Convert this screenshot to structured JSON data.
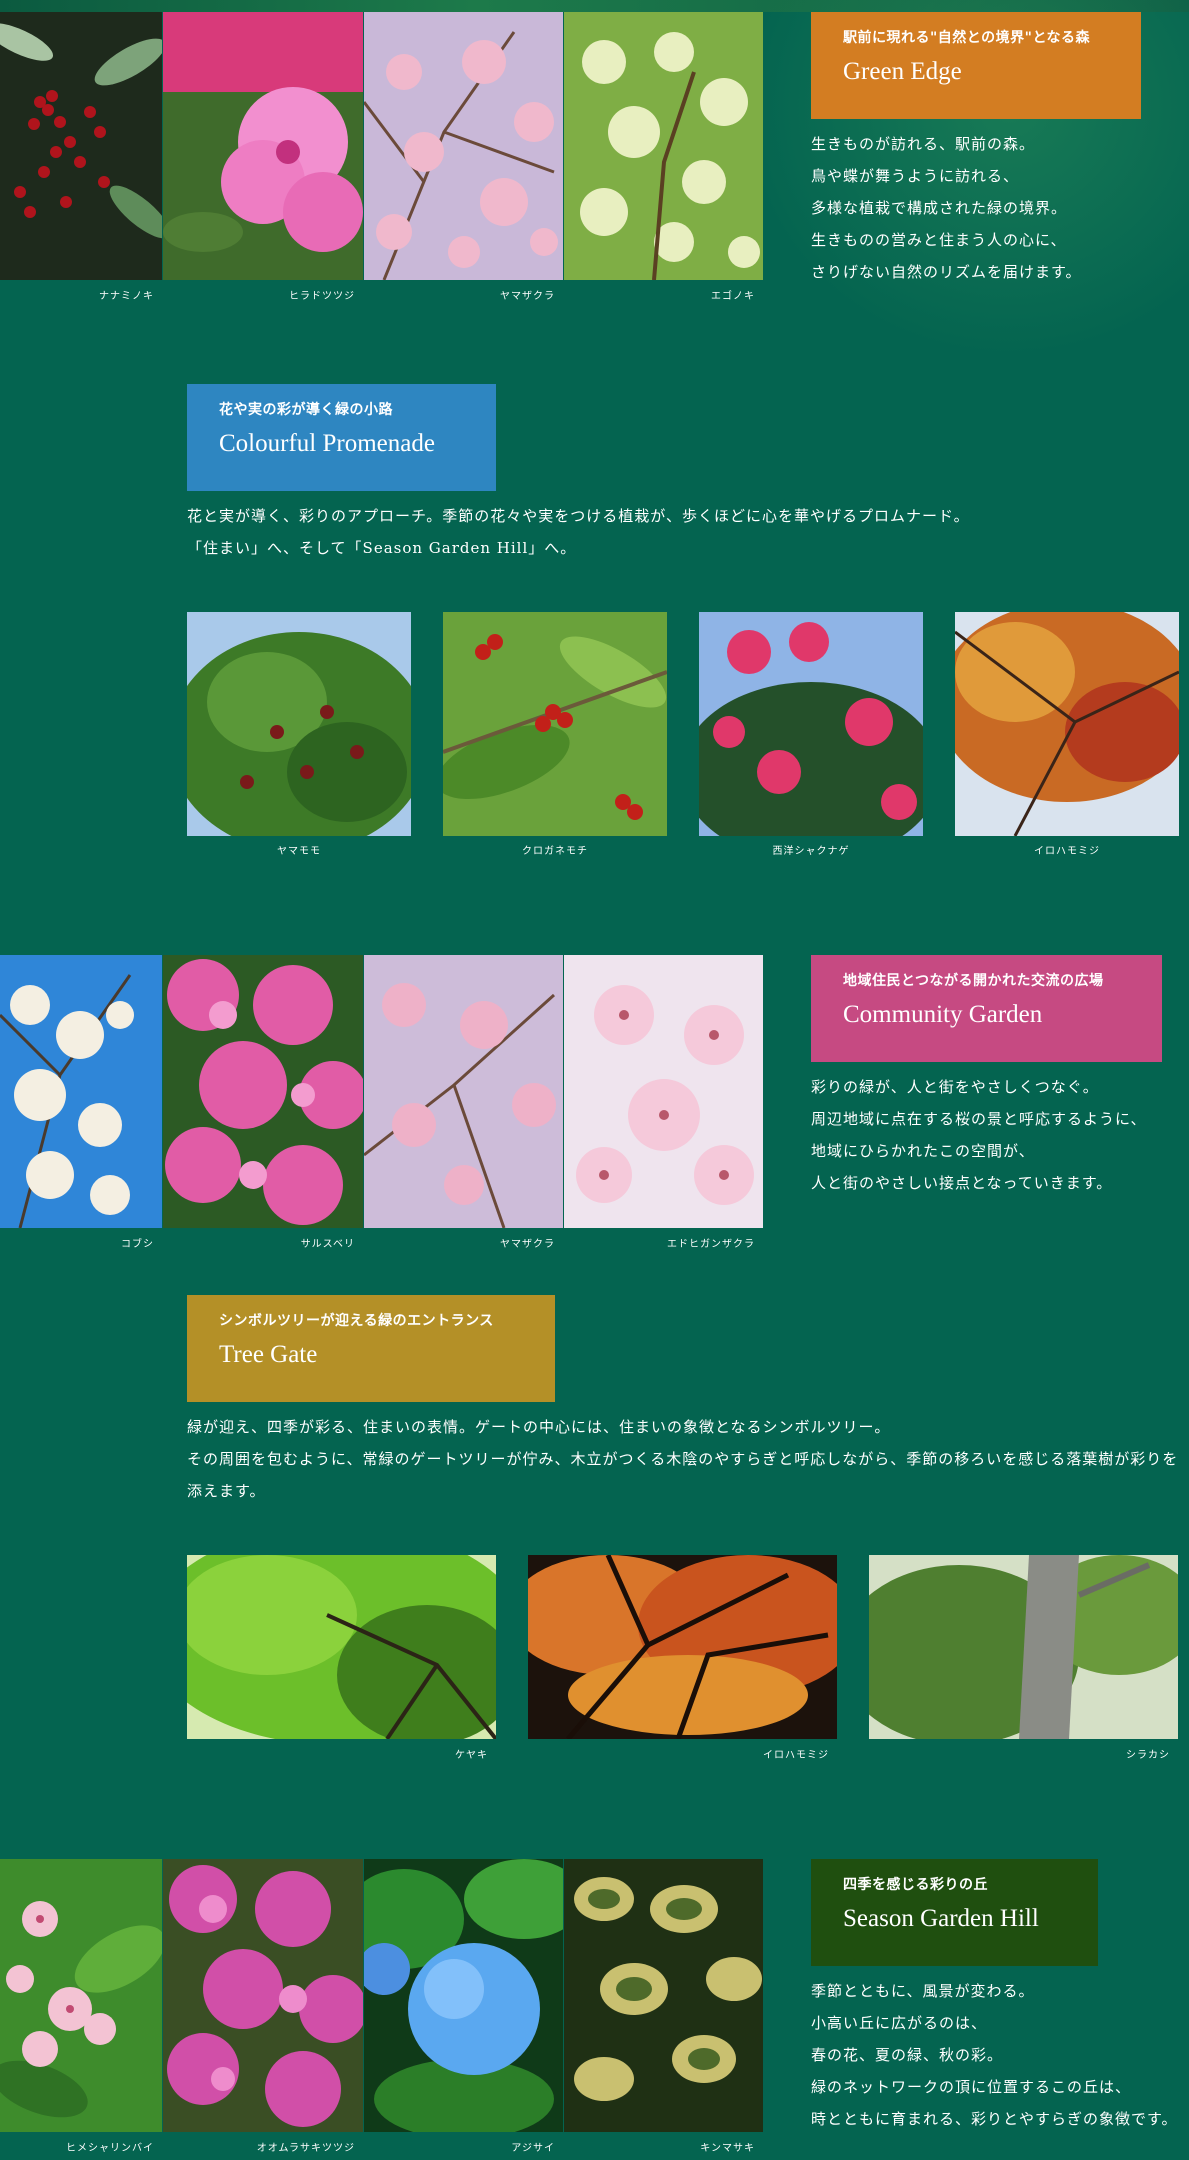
{
  "colors": {
    "background": "#046450",
    "green_edge": "#d37d22",
    "colourful_promenade": "#2e86c1",
    "community_garden": "#c64a82",
    "tree_gate": "#b49027",
    "season_garden_hill": "#1f4f0f"
  },
  "sections": {
    "green_edge": {
      "subtitle": "駅前に現れる\"自然との境界\"となる森",
      "title": "Green Edge",
      "lines": [
        "生きものが訪れる、駅前の森。",
        "鳥や蝶が舞うように訪れる、",
        "多様な植栽で構成された緑の境界。",
        "生きものの営みと住まう人の心に、",
        "さりげない自然のリズムを届けます。"
      ],
      "photos": [
        {
          "caption": "ナナミノキ",
          "icon": "holly-berries-photo"
        },
        {
          "caption": "ヒラドツツジ",
          "icon": "azalea-photo"
        },
        {
          "caption": "ヤマザクラ",
          "icon": "cherry-blossom-photo"
        },
        {
          "caption": "エゴノキ",
          "icon": "snowbell-photo"
        }
      ]
    },
    "colourful_promenade": {
      "subtitle": "花や実の彩が導く緑の小路",
      "title": "Colourful Promenade",
      "lines": [
        "花と実が導く、彩りのアプローチ。季節の花々や実をつける植栽が、歩くほどに心を華やげるプロムナード。",
        "「住まい」へ、そして「Season Garden Hill」へ。"
      ],
      "photos": [
        {
          "caption": "ヤマモモ",
          "icon": "bayberry-photo"
        },
        {
          "caption": "クロガネモチ",
          "icon": "holly-photo"
        },
        {
          "caption": "西洋シャクナゲ",
          "icon": "rhododendron-photo"
        },
        {
          "caption": "イロハモミジ",
          "icon": "maple-photo"
        }
      ]
    },
    "community_garden": {
      "subtitle": "地域住民とつながる開かれた交流の広場",
      "title": "Community Garden",
      "lines": [
        "彩りの緑が、人と街をやさしくつなぐ。",
        "周辺地域に点在する桜の景と呼応するように、",
        "地域にひらかれたこの空間が、",
        "人と街のやさしい接点となっていきます。"
      ],
      "photos": [
        {
          "caption": "コブシ",
          "icon": "magnolia-photo"
        },
        {
          "caption": "サルスベリ",
          "icon": "crape-myrtle-photo"
        },
        {
          "caption": "ヤマザクラ",
          "icon": "cherry-blossom-photo"
        },
        {
          "caption": "エドヒガンザクラ",
          "icon": "edo-higan-cherry-photo"
        }
      ]
    },
    "tree_gate": {
      "subtitle": "シンボルツリーが迎える緑のエントランス",
      "title": "Tree Gate",
      "lines": [
        "緑が迎え、四季が彩る、住まいの表情。ゲートの中心には、住まいの象徴となるシンボルツリー。",
        "その周囲を包むように、常緑のゲートツリーが佇み、木立がつくる木陰のやすらぎと呼応しながら、季節の移ろいを感じる落葉樹が彩りを",
        "添えます。"
      ],
      "photos": [
        {
          "caption": "ケヤキ",
          "icon": "zelkova-photo"
        },
        {
          "caption": "イロハモミジ",
          "icon": "autumn-maple-photo"
        },
        {
          "caption": "シラカシ",
          "icon": "white-oak-photo"
        }
      ]
    },
    "season_garden_hill": {
      "subtitle": "四季を感じる彩りの丘",
      "title": "Season Garden Hill",
      "lines": [
        "季節とともに、風景が変わる。",
        "小高い丘に広がるのは、",
        "春の花、夏の緑、秋の彩。",
        "緑のネットワークの頂に位置するこの丘は、",
        "時とともに育まれる、彩りとやすらぎの象徴です。"
      ],
      "photos": [
        {
          "caption": "ヒメシャリンバイ",
          "icon": "indian-hawthorn-photo"
        },
        {
          "caption": "オオムラサキツツジ",
          "icon": "purple-azalea-photo"
        },
        {
          "caption": "アジサイ",
          "icon": "hydrangea-photo"
        },
        {
          "caption": "キンマサキ",
          "icon": "golden-euonymus-photo"
        }
      ]
    }
  }
}
